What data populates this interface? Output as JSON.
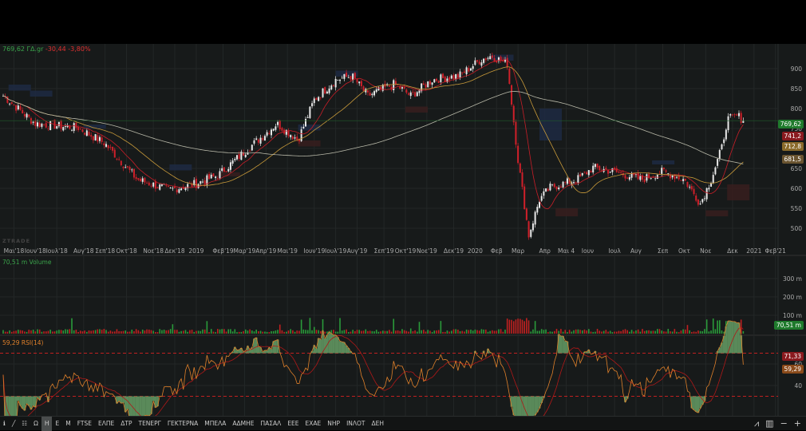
{
  "header": {
    "price": "769,62 ΓΔ.gr",
    "change": "-30,44",
    "change_pct": "-3,80%"
  },
  "watermark": "ZTRADE",
  "volume_label": "70,51 m Volume",
  "rsi_label": "59,29 RSI(14)",
  "tags": {
    "last": "769,62",
    "ma_short": "741,2",
    "ma_mid": "712,8",
    "ma_long": "681,5",
    "volume": "70,51 m",
    "rsi_upper": "71,33",
    "rsi": "59,29"
  },
  "colors": {
    "up": "#e8e8e8",
    "down": "#d0202a",
    "ma_short": "#c81e28",
    "ma_mid": "#c89a3a",
    "ma_long": "#b8b8a8",
    "vol_up": "#2a9a3a",
    "vol_down": "#c02020",
    "rsi": "#e0802a",
    "accent": "#2a9a3a"
  },
  "toolbar": {
    "items": [
      "Ω",
      "Η",
      "Ε",
      "Μ",
      "FTSE",
      "ΕΛΠΕ",
      "ΔΤΡ",
      "ΤΕΝΕΡΓ",
      "ΓΕΚΤΕΡΝΑ",
      "ΜΠΕΛΑ",
      "ΑΔΜΗΕ",
      "ΠΑΣΑΛ",
      "ΕΕΕ",
      "ΕΧΑΕ",
      "ΝΗΡ",
      "ΙΝΛΟΤ",
      "ΔΕΗ"
    ],
    "active": 1
  },
  "chart_data": [
    {
      "type": "candlestick",
      "title": "769,62 ΓΔ.gr",
      "ylim": [
        460,
        940
      ],
      "yticks": [
        500,
        550,
        600,
        650,
        700,
        750,
        800,
        850,
        900
      ],
      "xticks": [
        [
          "Μαι'18",
          2
        ],
        [
          "Ιουν'18",
          6
        ],
        [
          "Ιουλ'18",
          10
        ],
        [
          "Αυγ'18",
          15
        ],
        [
          "Σεπ'18",
          19
        ],
        [
          "Οκτ'18",
          23
        ],
        [
          "Νοε'18",
          28
        ],
        [
          "Δεκ'18",
          32
        ],
        [
          "2019",
          36
        ],
        [
          "Φεβ'19",
          41
        ],
        [
          "Μαρ'19",
          45
        ],
        [
          "Απρ'19",
          49
        ],
        [
          "Μαι'19",
          53
        ],
        [
          "Ιουν'19",
          58
        ],
        [
          "Ιουλ'19",
          62
        ],
        [
          "Αυγ'19",
          66
        ],
        [
          "Σεπ'19",
          71
        ],
        [
          "Οκτ'19",
          75
        ],
        [
          "Νοε'19",
          79
        ],
        [
          "Δεκ'19",
          84
        ],
        [
          "2020",
          88
        ],
        [
          "Φεβ",
          92
        ],
        [
          "Μαρ",
          96
        ],
        [
          "Απρ",
          101
        ],
        [
          "Μαι 4",
          105
        ],
        [
          "Ιουν",
          109
        ],
        [
          "Ιουλ",
          114
        ],
        [
          "Αυγ",
          118
        ],
        [
          "Σεπ",
          123
        ],
        [
          "Οκτ",
          127
        ],
        [
          "Νοε",
          131
        ],
        [
          "Δεκ",
          136
        ],
        [
          "2021",
          140
        ],
        [
          "Φεβ'21",
          144
        ]
      ],
      "closes_weekly_keypoints": [
        [
          0,
          832
        ],
        [
          6,
          762
        ],
        [
          14,
          752
        ],
        [
          19,
          712
        ],
        [
          25,
          622
        ],
        [
          31,
          596
        ],
        [
          36,
          612
        ],
        [
          40,
          632
        ],
        [
          45,
          692
        ],
        [
          51,
          762
        ],
        [
          55,
          722
        ],
        [
          58,
          822
        ],
        [
          62,
          872
        ],
        [
          65,
          882
        ],
        [
          68,
          832
        ],
        [
          73,
          862
        ],
        [
          76,
          832
        ],
        [
          80,
          872
        ],
        [
          85,
          882
        ],
        [
          89,
          922
        ],
        [
          91,
          932
        ],
        [
          94,
          912
        ],
        [
          96,
          672
        ],
        [
          98,
          482
        ],
        [
          100,
          572
        ],
        [
          102,
          602
        ],
        [
          107,
          622
        ],
        [
          110,
          652
        ],
        [
          114,
          642
        ],
        [
          119,
          622
        ],
        [
          123,
          642
        ],
        [
          127,
          622
        ],
        [
          130,
          562
        ],
        [
          132,
          622
        ],
        [
          134,
          702
        ],
        [
          135,
          772
        ],
        [
          137,
          782
        ],
        [
          138,
          769.62
        ]
      ],
      "moving_averages": [
        {
          "name": "short",
          "last": 741.2
        },
        {
          "name": "mid",
          "last": 712.8
        },
        {
          "name": "long",
          "last": 681.5
        }
      ]
    },
    {
      "type": "bar",
      "title": "Volume",
      "ylim": [
        0,
        350
      ],
      "yticks": [
        100,
        200,
        300
      ],
      "unit": "m",
      "last": 70.51
    },
    {
      "type": "line",
      "title": "RSI(14)",
      "ylim": [
        15,
        85
      ],
      "yticks": [
        40,
        60
      ],
      "levels": [
        70,
        30
      ],
      "last": 59.29,
      "signal_last": 71.33
    }
  ]
}
